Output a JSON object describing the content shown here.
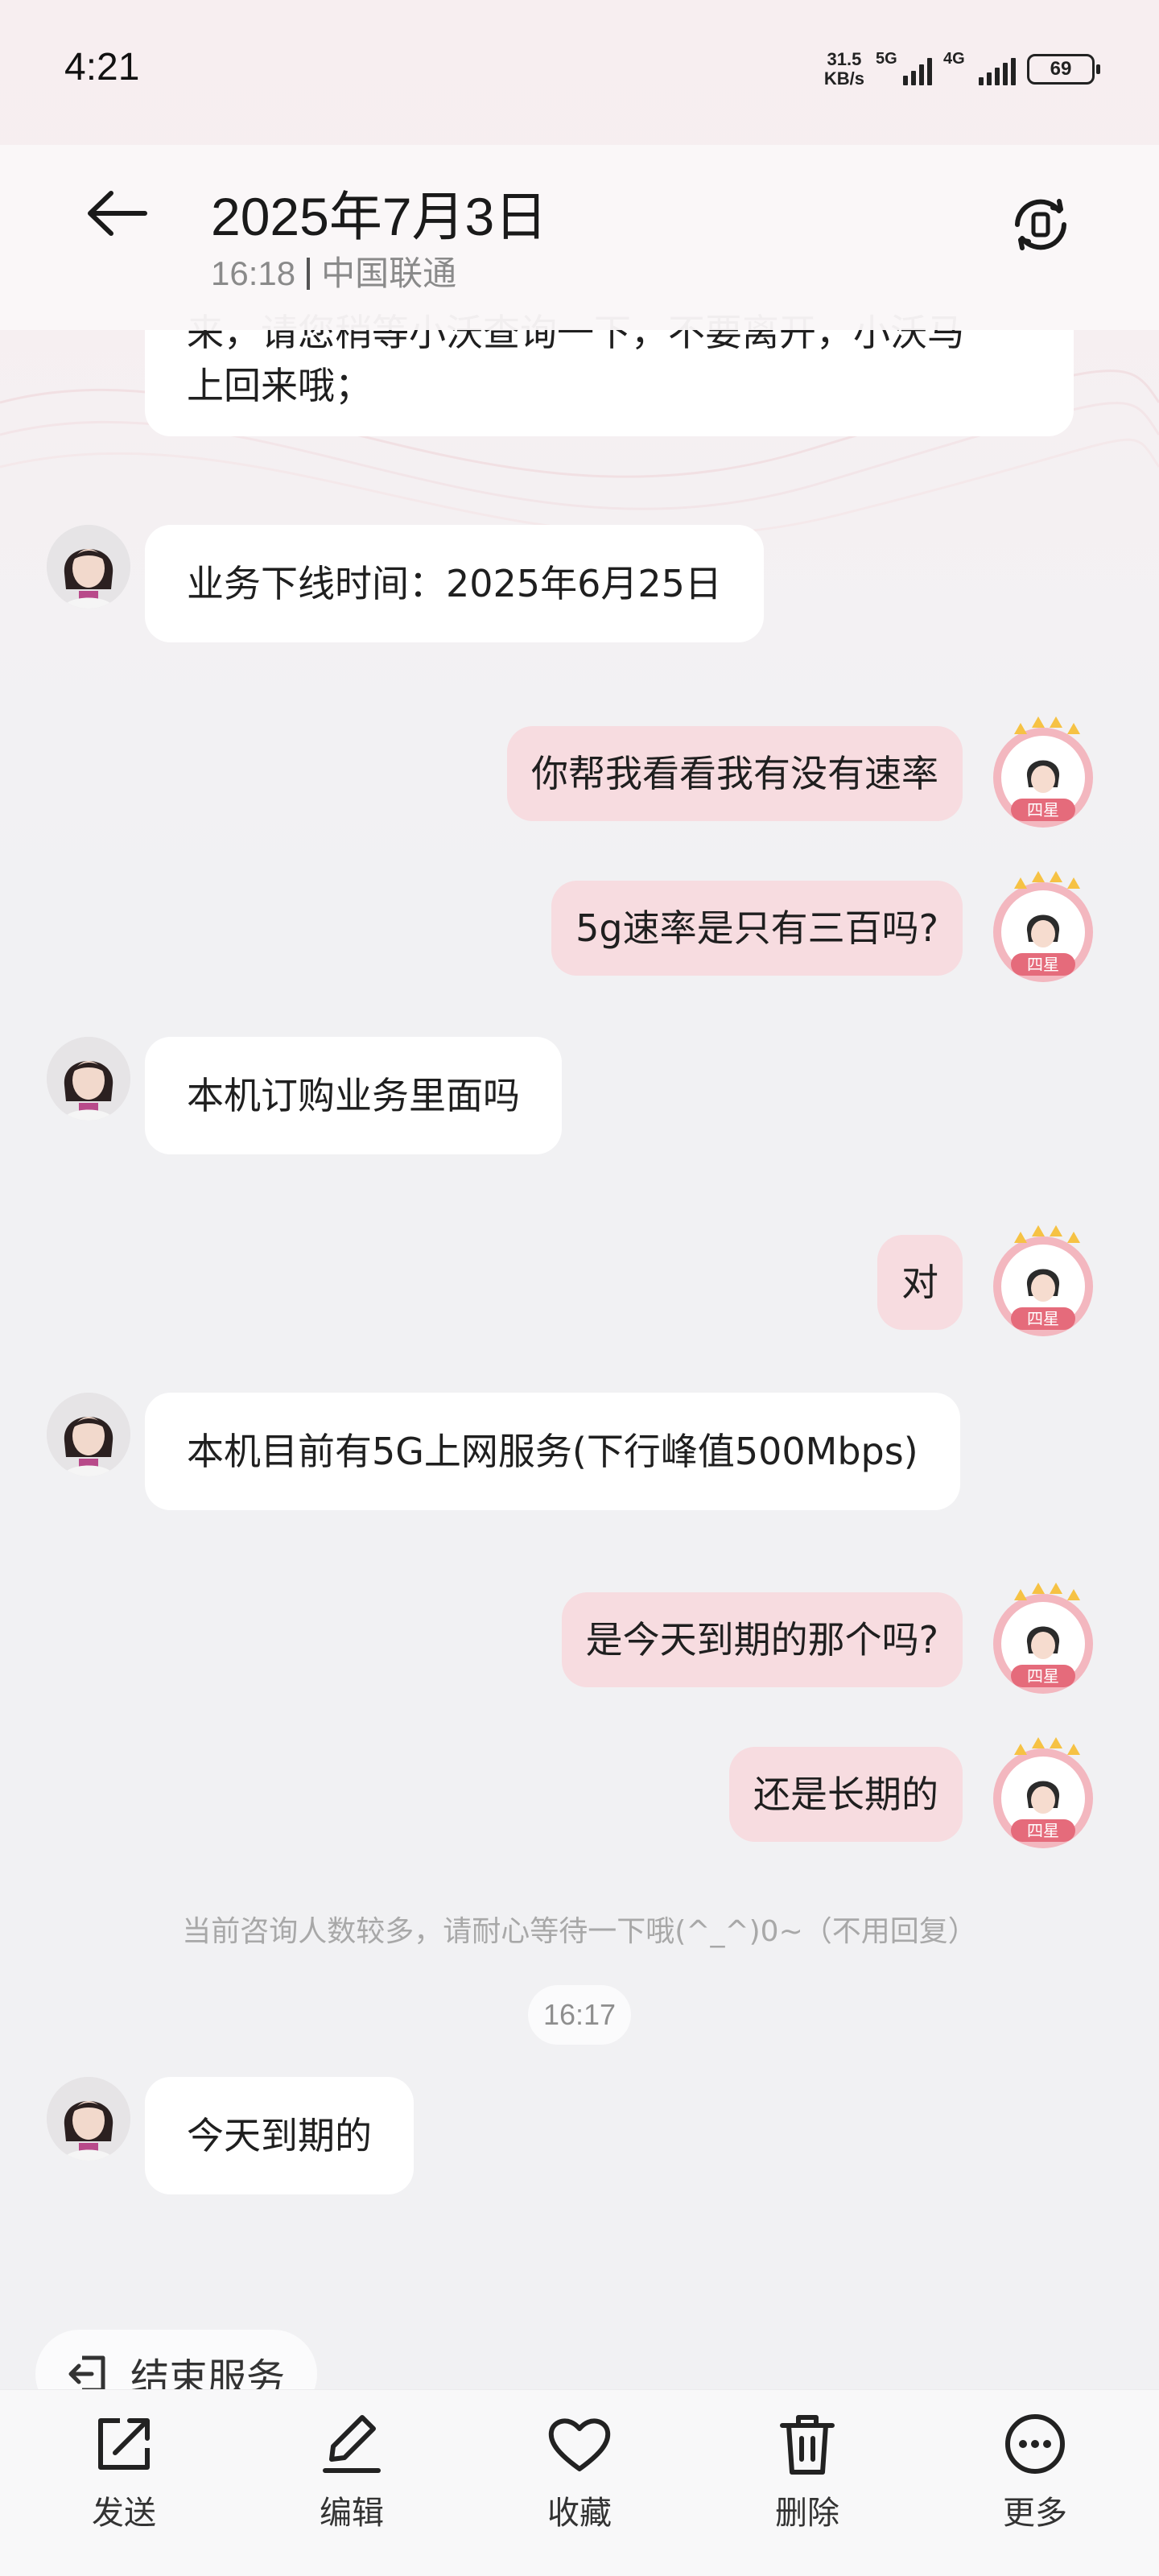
{
  "status_bar": {
    "time": "4:21",
    "net_speed_value": "31.5",
    "net_speed_unit": "KB/s",
    "signal1_label": "5G",
    "signal2_label": "4G",
    "battery": "69"
  },
  "header": {
    "title": "2025年7月3日",
    "time": "16:18",
    "carrier": "中国联通"
  },
  "messages": {
    "m0_line1": "来，请您稍等小沃查询一下，不要离开，小沃马",
    "m0_line2": "上回来哦；",
    "m1": "业务下线时间：2025年6月25日",
    "m2": "你帮我看看我有没有速率",
    "m3": "5g速率是只有三百吗?",
    "m4": "本机订购业务里面吗",
    "m5": "对",
    "m6": "本机目前有5G上网服务(下行峰值500Mbps)",
    "m7": "是今天到期的那个吗?",
    "m8": "还是长期的",
    "m9": "今天到期的"
  },
  "system_note": "当前咨询人数较多，请耐心等待一下哦(^_^)0~（不用回复）",
  "timestamp": "16:17",
  "user_badge": "四星",
  "end_service": "结束服务",
  "toolbar": {
    "send": "发送",
    "edit": "编辑",
    "favorite": "收藏",
    "delete": "删除",
    "more": "更多"
  }
}
